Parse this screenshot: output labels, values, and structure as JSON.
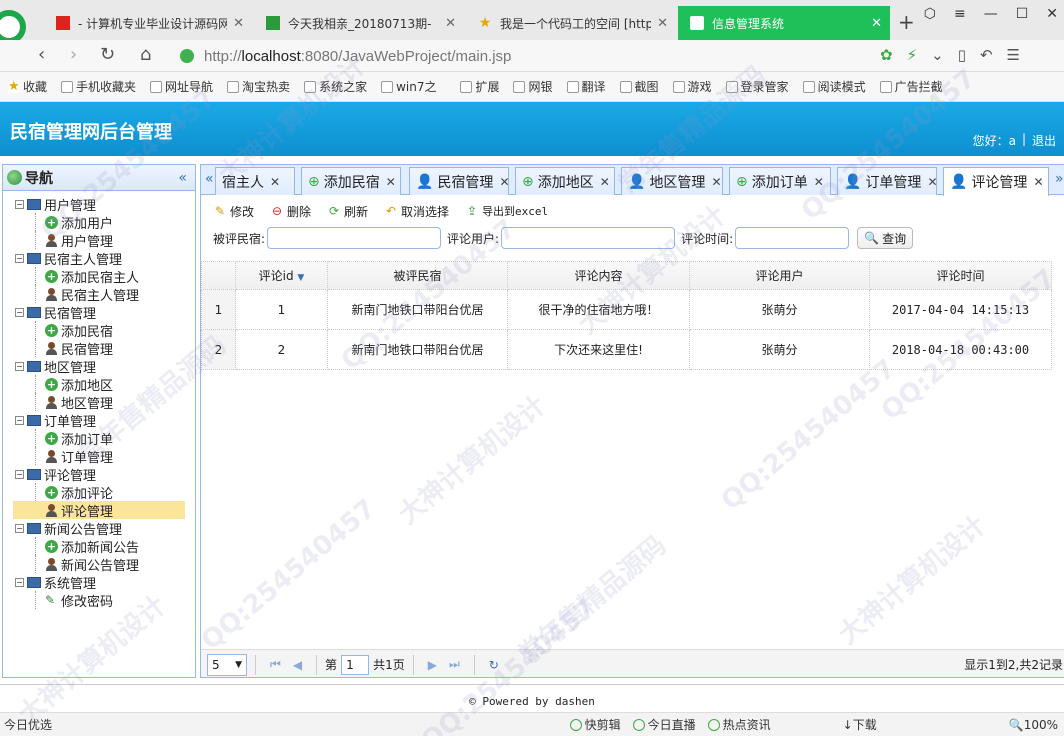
{
  "browser": {
    "tabs": [
      {
        "title": "- 计算机专业毕业设计源码网",
        "active": false
      },
      {
        "title": "今天我相亲_20180713期-",
        "active": false
      },
      {
        "title": "我是一个代码工的空间 [http",
        "active": false
      },
      {
        "title": "信息管理系统",
        "active": true
      }
    ],
    "url_prefix": "http://",
    "url_host": "localhost",
    "url_rest": ":8080/JavaWebProject/main.jsp",
    "favorites": [
      "收藏",
      "手机收藏夹",
      "网址导航",
      "淘宝热卖",
      "系统之家",
      "win7之",
      "扩展",
      "网银",
      "翻译",
      "截图",
      "游戏",
      "登录管家",
      "阅读模式",
      "广告拦截"
    ],
    "status_items": [
      "今日优选",
      "快剪辑",
      "今日直播",
      "热点资讯",
      "下载",
      "100%"
    ]
  },
  "app": {
    "title": "民宿管理网后台管理",
    "greeting": "您好：a",
    "sep": "|",
    "logout": "退出"
  },
  "sidebar": {
    "title": "导航",
    "groups": [
      {
        "label": "用户管理",
        "items": [
          "添加用户",
          "用户管理"
        ]
      },
      {
        "label": "民宿主人管理",
        "items": [
          "添加民宿主人",
          "民宿主人管理"
        ]
      },
      {
        "label": "民宿管理",
        "items": [
          "添加民宿",
          "民宿管理"
        ]
      },
      {
        "label": "地区管理",
        "items": [
          "添加地区",
          "地区管理"
        ]
      },
      {
        "label": "订单管理",
        "items": [
          "添加订单",
          "订单管理"
        ]
      },
      {
        "label": "评论管理",
        "items": [
          "添加评论",
          "评论管理"
        ]
      },
      {
        "label": "新闻公告管理",
        "items": [
          "添加新闻公告",
          "新闻公告管理"
        ]
      },
      {
        "label": "系统管理",
        "items": [
          "修改密码"
        ]
      }
    ],
    "selected": "评论管理"
  },
  "tabs": [
    "宿主人",
    "添加民宿",
    "民宿管理",
    "添加地区",
    "地区管理",
    "添加订单",
    "订单管理",
    "评论管理"
  ],
  "active_tab": "评论管理",
  "toolbar": {
    "edit": "修改",
    "delete": "删除",
    "refresh": "刷新",
    "cancel_select": "取消选择",
    "export": "导出到excel"
  },
  "search": {
    "homestay_label": "被评民宿:",
    "user_label": "评论用户:",
    "time_label": "评论时间:",
    "homestay_value": "",
    "user_value": "",
    "time_value": "",
    "query": "查询"
  },
  "grid": {
    "columns": [
      "评论id",
      "被评民宿",
      "评论内容",
      "评论用户",
      "评论时间"
    ],
    "rows": [
      {
        "rn": "1",
        "id": "1",
        "homestay": "新南门地铁口带阳台优居",
        "content": "很干净的住宿地方哦！",
        "user": "张萌分",
        "time": "2017-04-04 14:15:13"
      },
      {
        "rn": "2",
        "id": "2",
        "homestay": "新南门地铁口带阳台优居",
        "content": "下次还来这里住!",
        "user": "张萌分",
        "time": "2018-04-18 00:43:00"
      }
    ]
  },
  "pager": {
    "size": "5",
    "page_prefix": "第",
    "page": "1",
    "page_suffix": "共1页",
    "info": "显示1到2,共2记录"
  },
  "footer": "Powered by dashen",
  "watermarks": [
    "QQ:254540457",
    "大神计算机设计",
    "常年售精品源码"
  ]
}
